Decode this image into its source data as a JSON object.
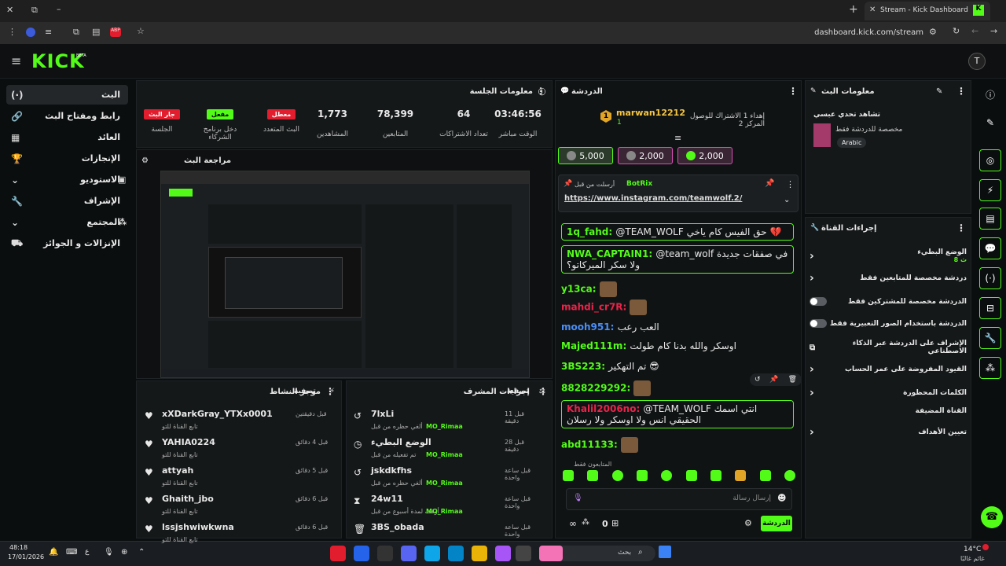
{
  "browser": {
    "tab_title": "Stream - Kick Dashboard",
    "url": "dashboard.kick.com/stream"
  },
  "header": {
    "logo": "KICK",
    "logo_sup": "BETA",
    "avatar_letter": "T"
  },
  "nav": {
    "items": [
      {
        "label": "البث",
        "icon": "(·)"
      },
      {
        "label": "رابط ومفتاح البث",
        "icon": "🔗"
      },
      {
        "label": "العائد",
        "icon": "▦"
      },
      {
        "label": "الإنجازات",
        "icon": "🏆"
      },
      {
        "label": "الاستوديو",
        "icon": "▣"
      },
      {
        "label": "الإشراف",
        "icon": "🔧"
      },
      {
        "label": "المجتمع",
        "icon": "👥"
      },
      {
        "label": "الإنزالات و الجوائز",
        "icon": "⛟"
      }
    ]
  },
  "session": {
    "title": "معلومات الجلسة",
    "stats": [
      {
        "value": "03:46:56",
        "label": "الوقت مباشر"
      },
      {
        "value": "64",
        "label": "تعداد الاشتراكات"
      },
      {
        "value": "78,399",
        "label": "المتابعين"
      },
      {
        "value": "1,773",
        "label": "المشاهدين"
      }
    ],
    "badges": [
      {
        "value": "معطل",
        "label": "البث المتعدد"
      },
      {
        "value": "مفعل",
        "label": "دخل برنامج الشركاء"
      },
      {
        "value": "جار البث",
        "label": "الجلسة"
      }
    ]
  },
  "preview": {
    "title": "مراجعة البث"
  },
  "activity": {
    "title": "موجز النشاط",
    "filter": "تصفية",
    "items": [
      {
        "name": "xXDarkGray_YTXx0001",
        "sub": "تابع القناة للتو",
        "time": "قبل دقيقتين"
      },
      {
        "name": "YAHIA0224",
        "sub": "تابع القناة للتو",
        "time": "قبل 4 دقائق"
      },
      {
        "name": "attyah",
        "sub": "تابع القناة للتو",
        "time": "قبل 5 دقائق"
      },
      {
        "name": "Ghaith_jbo",
        "sub": "تابع القناة للتو",
        "time": "قبل 6 دقائق"
      },
      {
        "name": "lssjshwiwkwna",
        "sub": "تابع القناة للتو",
        "time": "قبل 6 دقائق"
      }
    ]
  },
  "modactions": {
    "title": "إجراءات المشرف",
    "filter": "تصفية",
    "items": [
      {
        "name": "7lxLi",
        "sub": "ألغي حظره من قبل",
        "mod": "MO_Rimaa",
        "time": "قبل 11 دقيقة",
        "icon": "↺"
      },
      {
        "name": "الوضع البطيء",
        "sub": "تم تفعيله من قبل",
        "mod": "MO_Rimaa",
        "time": "قبل 28 دقيقة",
        "icon": "◷"
      },
      {
        "name": "jskdkfhs",
        "sub": "ألغي حظره من قبل",
        "mod": "MO_Rimaa",
        "time": "قبل ساعة واحدة",
        "icon": "↺"
      },
      {
        "name": "24w11",
        "sub": "أوقف لمدة أسبوع من قبل",
        "mod": "MO_Rimaa",
        "time": "قبل ساعة واحدة",
        "icon": "⧗"
      },
      {
        "name": "3BS_obada",
        "sub": "",
        "mod": "",
        "time": "قبل ساعة واحدة",
        "icon": "🗑"
      }
    ]
  },
  "chat": {
    "title": "الدردشة",
    "top_gifter": {
      "name": "marwan12212",
      "rank": "1",
      "sub_count": "1",
      "text": "إهداء 1 الاشتراك للوصول المركز 2"
    },
    "gift_buttons": [
      "5,000",
      "2,000",
      "2,000"
    ],
    "pinned": {
      "author": "BotRix",
      "label": "أرسلت من قبل",
      "link": "https://www.instagram.com/teamwolf.2/"
    },
    "messages": [
      {
        "user": "1q_fahd",
        "color": "#53fc18",
        "text": "@TEAM_WOLF حق الفيس كام ياخي 💔",
        "boxed": true
      },
      {
        "user": "NWA_CAPTAIN1",
        "color": "#53fc18",
        "text": "@team_wolf في صفقات جديدة ولا سكر الميركاتو؟",
        "boxed": true
      },
      {
        "user": "y13ca",
        "color": "#53fc18",
        "text": "",
        "boxed": false
      },
      {
        "user": "mahdi_cr7R",
        "color": "#e8244a",
        "text": "",
        "boxed": false
      },
      {
        "user": "mooh951",
        "color": "#4a8ef5",
        "text": "العب رعب",
        "boxed": false
      },
      {
        "user": "Majed111m",
        "color": "#53fc18",
        "text": "اوسكر والله بدنا كام طولت",
        "boxed": false
      },
      {
        "user": "3BS223",
        "color": "#53fc18",
        "text": "تم التهكير 😎",
        "boxed": false
      },
      {
        "user": "8828229292",
        "color": "#53fc18",
        "text": "",
        "boxed": false
      },
      {
        "user": "Khalil2006no",
        "color": "#e8244a",
        "text": "@TEAM_WOLF انتي اسمك الحقيقي انس ولا اوسكر ولا رسلان",
        "boxed": true
      },
      {
        "user": "abd11133",
        "color": "#53fc18",
        "text": "",
        "boxed": false
      }
    ],
    "followers_only": "المتابعون فقط",
    "input_placeholder": "إرسال رسالة",
    "send_label": "الدردشة",
    "counter": "0"
  },
  "streaminfo": {
    "title": "معلومات البث",
    "stream_title": "تشاهد تحدي عبسي",
    "category": "مخصصة للدردشة فقط",
    "language": "Arabic"
  },
  "channel": {
    "title": "إجراءات القناة",
    "rows": [
      {
        "label": "الوضع البطيء",
        "sub": "8 ث",
        "type": "arrow"
      },
      {
        "label": "دردشة مخصصة للمتابعين فقط",
        "type": "arrow"
      },
      {
        "label": "الدردشة مخصصة للمشتركين فقط",
        "type": "toggle"
      },
      {
        "label": "الدردشة باستخدام الصور التعبيرية فقط",
        "type": "toggle"
      },
      {
        "label": "الإشراف على الدردشة عبر الذكاء الاصطناعي",
        "type": "ext"
      },
      {
        "label": "القيود المفروضة على عمر الحساب",
        "type": "arrow"
      },
      {
        "label": "الكلمات المحظورة",
        "type": "arrow"
      },
      {
        "label": "القناة المضيفة",
        "type": "none"
      },
      {
        "label": "تعيين الأهداف",
        "type": "arrow"
      }
    ]
  },
  "taskbar": {
    "time": "48:18",
    "date": "17/01/2026",
    "search": "بحث",
    "weather_temp": "14°C",
    "weather_text": "غائم غالبًا"
  },
  "colors": {
    "accent": "#53fc18",
    "red": "#e11d2e",
    "bg": "#0b0e0f",
    "panel": "#151819"
  }
}
